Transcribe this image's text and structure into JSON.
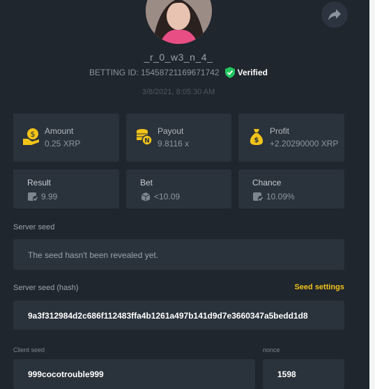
{
  "user": {
    "username": "_r_0_w3_n_4_",
    "betting_id": "BETTING ID: 15458721169671742",
    "verified_label": "Verified"
  },
  "timestamp": "3/8/2021, 8:05:30 AM",
  "stats": {
    "amount": {
      "label": "Amount",
      "value": "0.25 XRP"
    },
    "payout": {
      "label": "Payout",
      "value": "9.8116 x"
    },
    "profit": {
      "label": "Profit",
      "value": "+2.20290000 XRP"
    }
  },
  "details": {
    "result": {
      "label": "Result",
      "value": "9.99"
    },
    "bet": {
      "label": "Bet",
      "value": "<10.09"
    },
    "chance": {
      "label": "Chance",
      "value": "10.09%"
    }
  },
  "server_seed": {
    "label": "Server seed",
    "value": "The seed hasn't been revealed yet."
  },
  "server_seed_hash": {
    "label": "Server seed (hash)",
    "settings_label": "Seed settings",
    "value": "9a3f312984d2c686f112483ffa4b1261a497b141d9d7e3660347a5bedd1d8"
  },
  "client_seed": {
    "label": "Client seed",
    "value": "999cocotrouble999"
  },
  "nonce": {
    "label": "nonce",
    "value": "1598"
  },
  "colors": {
    "background": "#1f262e",
    "card": "#2a323b",
    "accent": "#f2c318",
    "verified": "#22c55e"
  },
  "icons": [
    "share-icon",
    "verified-shield-icon",
    "coin-hand-icon",
    "coin-stack-icon",
    "money-bag-icon",
    "dice-check-icon"
  ]
}
